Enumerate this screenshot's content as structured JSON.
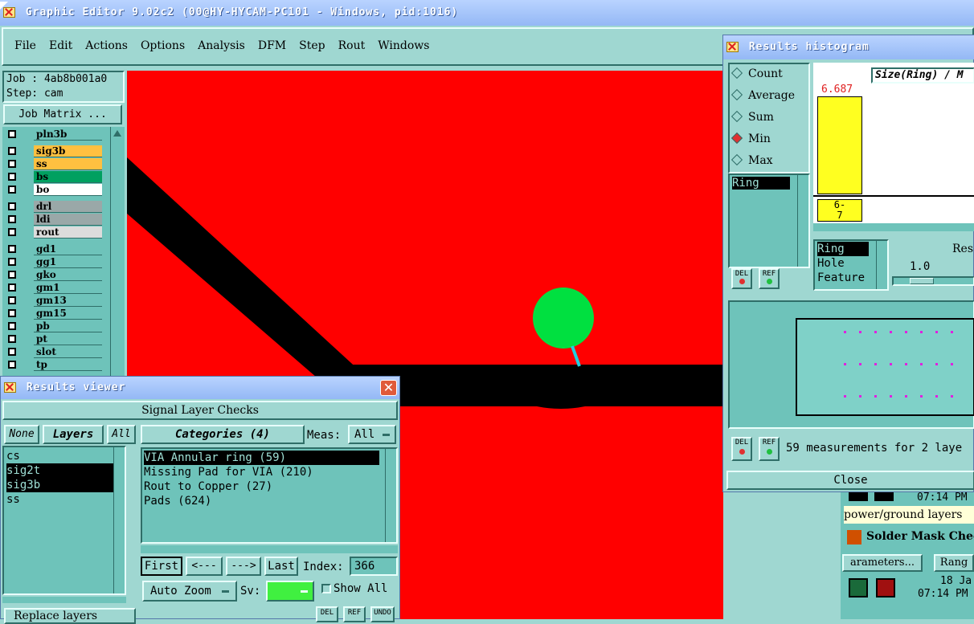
{
  "window": {
    "title": "Graphic Editor 9.02c2 (00@HY-HYCAM-PC101 - Windows, pid:1016)"
  },
  "menu": [
    "File",
    "Edit",
    "Actions",
    "Options",
    "Analysis",
    "DFM",
    "Step",
    "Rout",
    "Windows"
  ],
  "job": {
    "job_label": "Job : 4ab8b001a0",
    "step_label": "Step: cam",
    "matrix_button": "Job Matrix ..."
  },
  "layers": [
    {
      "name": "pln3b",
      "color": "#6ec3ba"
    },
    {
      "name": "sig3b",
      "color": "#ffc040"
    },
    {
      "name": "ss",
      "color": "#ffc040"
    },
    {
      "name": "bs",
      "color": "#00a060"
    },
    {
      "name": "bo",
      "color": "#ffffff"
    },
    {
      "name": "drl",
      "color": "#9aa8a8"
    },
    {
      "name": "ldi",
      "color": "#9aa8a8"
    },
    {
      "name": "rout",
      "color": "#dcdcdc"
    },
    {
      "name": "gd1",
      "color": "#6ec3ba"
    },
    {
      "name": "gg1",
      "color": "#6ec3ba"
    },
    {
      "name": "gko",
      "color": "#6ec3ba"
    },
    {
      "name": "gm1",
      "color": "#6ec3ba"
    },
    {
      "name": "gm13",
      "color": "#6ec3ba"
    },
    {
      "name": "gm15",
      "color": "#6ec3ba"
    },
    {
      "name": "pb",
      "color": "#6ec3ba"
    },
    {
      "name": "pt",
      "color": "#6ec3ba"
    },
    {
      "name": "slot",
      "color": "#6ec3ba"
    },
    {
      "name": "tp",
      "color": "#6ec3ba"
    }
  ],
  "results_viewer": {
    "title": "Results viewer",
    "header": "Signal Layer Checks",
    "none_btn": "None",
    "layers_btn": "Layers",
    "all_btn": "All",
    "layer_list": [
      {
        "name": "cs",
        "selected": false
      },
      {
        "name": "sig2t",
        "selected": true
      },
      {
        "name": "sig3b",
        "selected": true
      },
      {
        "name": "ss",
        "selected": false
      }
    ],
    "categories_btn": "Categories (4)",
    "meas_label": "Meas:",
    "meas_value": "All",
    "categories": [
      {
        "text": "VIA Annular ring (59)",
        "selected": true
      },
      {
        "text": "Missing Pad for VIA (210)",
        "selected": false
      },
      {
        "text": "Rout to Copper (27)",
        "selected": false
      },
      {
        "text": "Pads (624)",
        "selected": false
      }
    ],
    "first_btn": "First",
    "prev_btn": "<---",
    "next_btn": "--->",
    "last_btn": "Last",
    "index_label": "Index:",
    "index_value": "366",
    "auto_zoom": "Auto Zoom",
    "sv_label": "Sv:",
    "show_all": "Show All",
    "replace_layers": "Replace layers",
    "del": "DEL",
    "ref": "REF",
    "undo": "UNDO"
  },
  "histogram": {
    "title": "Results histogram",
    "modes": [
      {
        "label": "Count",
        "selected": false
      },
      {
        "label": "Average",
        "selected": false
      },
      {
        "label": "Sum",
        "selected": false
      },
      {
        "label": "Min",
        "selected": true
      },
      {
        "label": "Max",
        "selected": false
      }
    ],
    "size_label": "Size(Ring) / M",
    "bar_value": "6.687",
    "bin_label_1": "6-",
    "bin_label_2": "7",
    "ring_list": [
      "Ring"
    ],
    "measure_list": [
      {
        "text": "Ring",
        "selected": true
      },
      {
        "text": "Hole",
        "selected": false
      },
      {
        "text": "Feature",
        "selected": false
      }
    ],
    "res_label": "Res",
    "res_value": "1.0",
    "summary": "59 measurements for 2 laye",
    "close": "Close",
    "del": "DEL",
    "ref": "REF"
  },
  "background_panel": {
    "time_1": "07:14 PM",
    "power_ground": "power/ground layers",
    "solder_mask": "Solder Mask Checks",
    "parameters": "arameters...",
    "range": "Rang",
    "date": "18 Ja",
    "time_2": "07:14 PM"
  }
}
